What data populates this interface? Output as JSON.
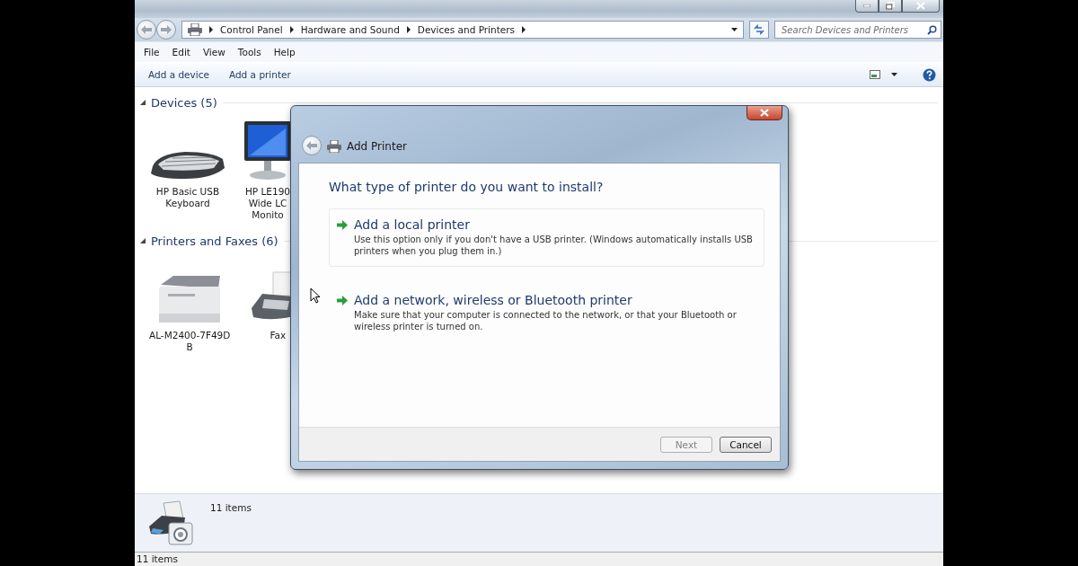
{
  "address_bar": {
    "crumbs": [
      "Control Panel",
      "Hardware and Sound",
      "Devices and Printers"
    ]
  },
  "search": {
    "placeholder": "Search Devices and Printers"
  },
  "menu": [
    "File",
    "Edit",
    "View",
    "Tools",
    "Help"
  ],
  "commands": [
    "Add a device",
    "Add a printer"
  ],
  "groups": [
    {
      "title": "Devices (5)",
      "expanded": true,
      "items": [
        {
          "kind": "keyboard",
          "label_lines": [
            "HP Basic USB",
            "Keyboard"
          ]
        },
        {
          "kind": "monitor",
          "label_lines": [
            "HP LE190",
            "Wide LC",
            "Monito"
          ]
        }
      ]
    },
    {
      "title": "Printers and Faxes (6)",
      "expanded": true,
      "items": [
        {
          "kind": "printer",
          "label_lines": [
            "AL-M2400-7F49D",
            "B"
          ]
        },
        {
          "kind": "fax",
          "label_lines": [
            "Fax"
          ]
        }
      ]
    }
  ],
  "details_pane": {
    "text": "11 items"
  },
  "status_bar": "11 items",
  "dialog": {
    "title": "Add Printer",
    "heading": "What type of printer do you want to install?",
    "options": [
      {
        "title": "Add a local printer",
        "description": "Use this option only if you don't have a USB printer. (Windows automatically installs USB printers when you plug them in.)",
        "highlighted": true
      },
      {
        "title": "Add a network, wireless or Bluetooth printer",
        "description": "Make sure that your computer is connected to the network, or that your Bluetooth or wireless printer is turned on.",
        "highlighted": false
      }
    ],
    "buttons": [
      {
        "label": "Next",
        "disabled": true
      },
      {
        "label": "Cancel",
        "disabled": false
      }
    ]
  }
}
